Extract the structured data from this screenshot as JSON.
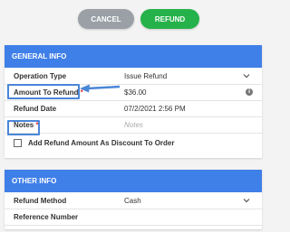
{
  "actions": {
    "cancel_label": "CANCEL",
    "refund_label": "REFUND",
    "cancel_color": "#9aa0a6",
    "refund_color": "#26b24a"
  },
  "general": {
    "header": "GENERAL INFO",
    "header_color": "#3f7fe8",
    "fields": [
      {
        "label": "Operation Type",
        "value": "Issue Refund",
        "control": "dropdown"
      },
      {
        "label": "Amount To Refund",
        "required": true,
        "value": "$36.00",
        "control": "info"
      },
      {
        "label": "Refund Date",
        "value": "07/2/2021 2:56 PM"
      },
      {
        "label": "Notes",
        "required": true,
        "placeholder": "Notes"
      }
    ],
    "checkbox": {
      "label": "Add Refund Amount As Discount To Order",
      "checked": false
    }
  },
  "other": {
    "header": "OTHER INFO",
    "fields": [
      {
        "label": "Refund Method",
        "value": "Cash",
        "control": "dropdown"
      },
      {
        "label": "Reference Number",
        "value": ""
      }
    ]
  },
  "annotation": {
    "color": "#4a86d8"
  },
  "symbols": {
    "required_mark": "*",
    "info_mark": "i"
  },
  "icons": [
    "chevron-down-icon",
    "info-icon",
    "arrow-annotation"
  ]
}
